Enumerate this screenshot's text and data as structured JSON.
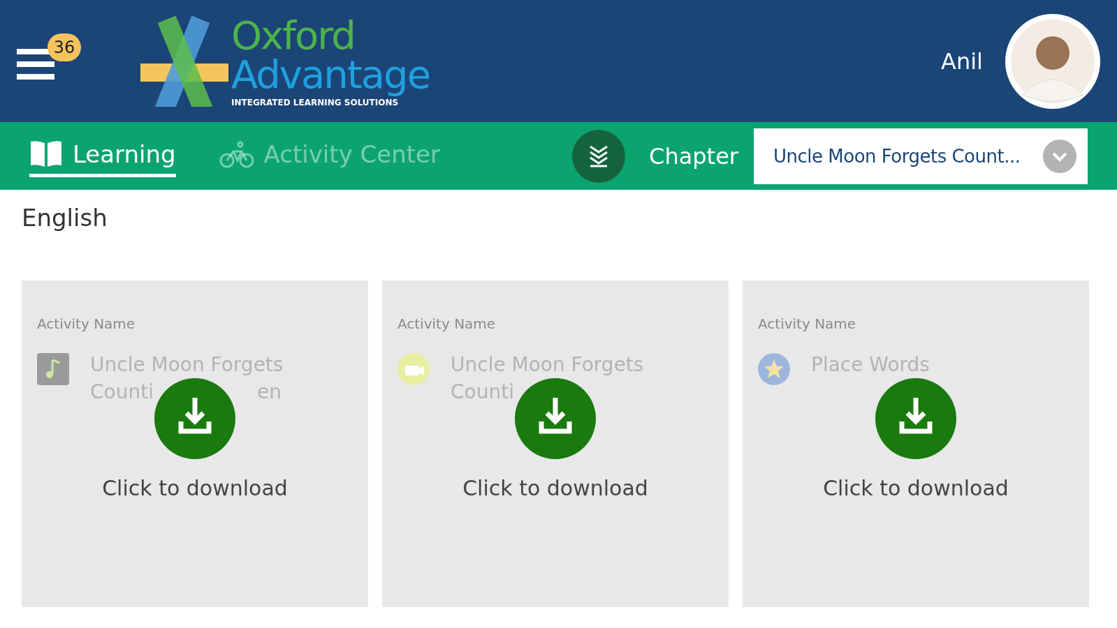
{
  "header": {
    "menu_badge": "36",
    "logo": {
      "line1": "Oxford",
      "line2": "Advantage",
      "tagline": "INTEGRATED LEARNING SOLUTIONS"
    },
    "user_name": "Anil"
  },
  "tabs": [
    {
      "label": "Learning",
      "selected": true,
      "kind": "book"
    },
    {
      "label": "Activity Center",
      "selected": false,
      "kind": "bike"
    }
  ],
  "chapter": {
    "label": "Chapter",
    "value": "Uncle Moon Forgets Count..."
  },
  "subject": "English",
  "cards": [
    {
      "field_label": "Activity Name",
      "kind": "audio",
      "title_parts": [
        "Uncle Moon Forgets",
        "Counti",
        "en"
      ],
      "action": "Click to download"
    },
    {
      "field_label": "Activity Name",
      "kind": "video",
      "title_parts": [
        "Uncle Moon Forgets",
        "Counti"
      ],
      "action": "Click to download"
    },
    {
      "field_label": "Activity Name",
      "kind": "star",
      "title_parts": [
        "Place Words"
      ],
      "action": "Click to download"
    }
  ]
}
